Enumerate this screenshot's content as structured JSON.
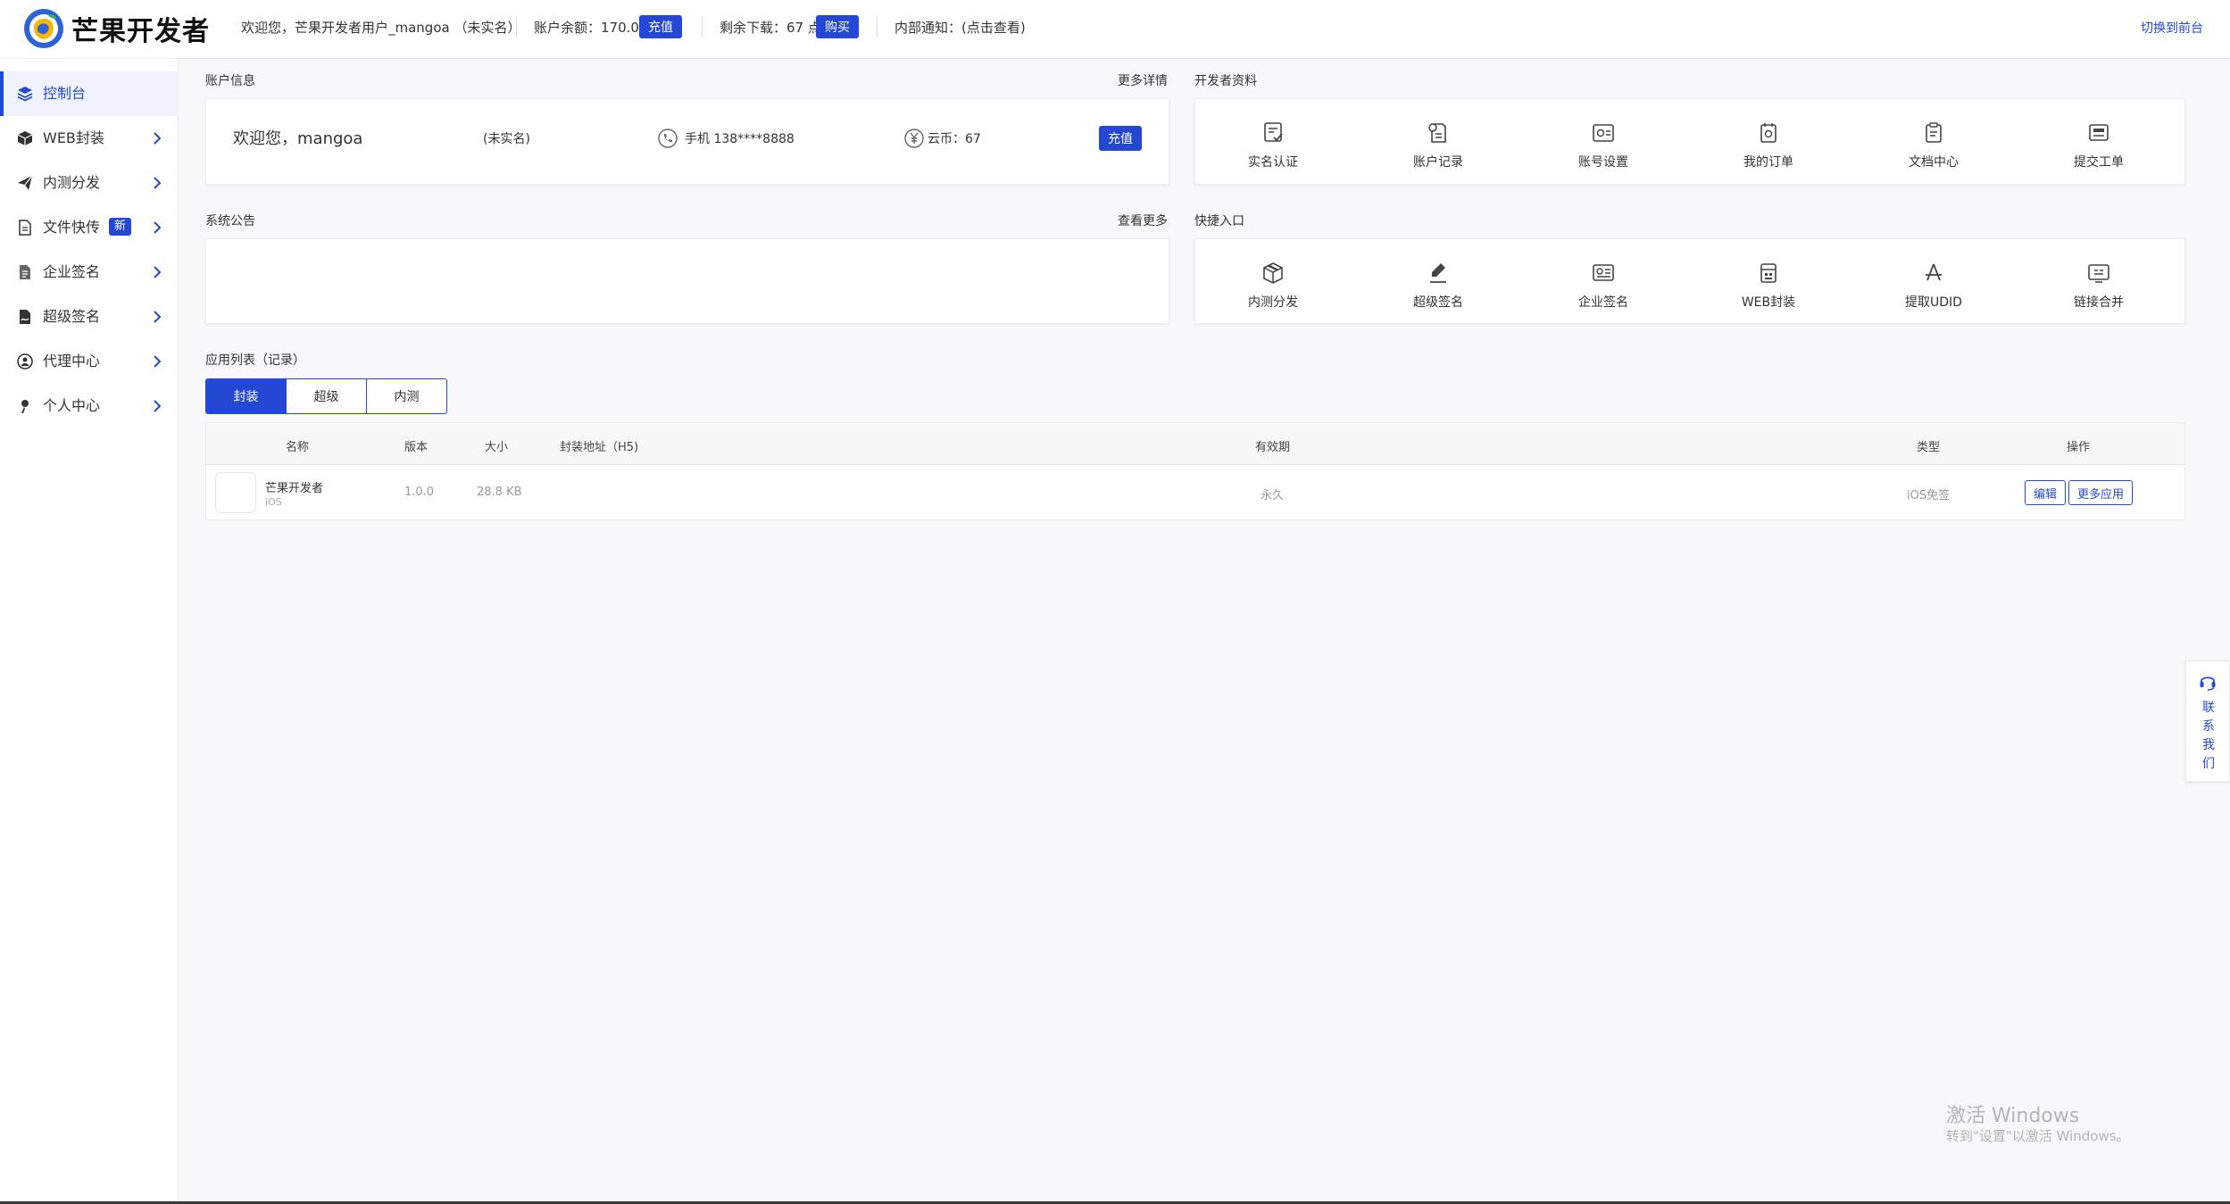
{
  "header": {
    "brand": "芒果开发者",
    "welcome": "欢迎您，芒果开发者用户_mangoa （未实名）",
    "balance_label": "账户余额：170.00",
    "recharge_label": "充值",
    "downloads_label": "剩余下载：67 点",
    "buy_label": "购买",
    "notice_label": "内部通知：(点击查看)",
    "switch_front": "切换到前台"
  },
  "sidebar": {
    "items": [
      {
        "label": "控制台",
        "icon": "layers-icon"
      },
      {
        "label": "WEB封装",
        "icon": "box-icon"
      },
      {
        "label": "内测分发",
        "icon": "paper-plane-icon"
      },
      {
        "label": "文件快传",
        "icon": "file-icon",
        "badge": "新"
      },
      {
        "label": "企业签名",
        "icon": "document-icon"
      },
      {
        "label": "超级签名",
        "icon": "file-signature-icon"
      },
      {
        "label": "代理中心",
        "icon": "globe-user-icon"
      },
      {
        "label": "个人中心",
        "icon": "user-icon"
      }
    ]
  },
  "account": {
    "title": "账户信息",
    "more": "更多详情",
    "greeting": "欢迎您，mangoa",
    "status": "(未实名)",
    "phone": "手机 138****8888",
    "coins": "云币：67",
    "recharge": "充值"
  },
  "dev_docs": {
    "title": "开发者资料",
    "items": [
      "实名认证",
      "账户记录",
      "账号设置",
      "我的订单",
      "文档中心",
      "提交工单"
    ]
  },
  "announcement": {
    "title": "系统公告",
    "more": "查看更多"
  },
  "quick": {
    "title": "快捷入口",
    "items": [
      "内测分发",
      "超级签名",
      "企业签名",
      "WEB封装",
      "提取UDID",
      "链接合并"
    ]
  },
  "app_list": {
    "title": "应用列表（记录）",
    "tabs": [
      "封装",
      "超级",
      "内测"
    ],
    "columns": [
      "名称",
      "版本",
      "大小",
      "封装地址（H5)",
      "有效期",
      "类型",
      "操作"
    ],
    "rows": [
      {
        "name": "芒果开发者",
        "platform": "iOS",
        "version": "1.0.0",
        "size": "28.8 KB",
        "url": "",
        "validity": "永久",
        "type": "iOS免签",
        "actions": [
          "编辑",
          "更多应用"
        ]
      }
    ]
  },
  "contact": {
    "label": "联系我们"
  },
  "watermark": {
    "line1": "激活 Windows",
    "line2": "转到\"设置\"以激活 Windows。"
  },
  "colors": {
    "accent": "#2548d4",
    "background": "#f8f8fa"
  }
}
